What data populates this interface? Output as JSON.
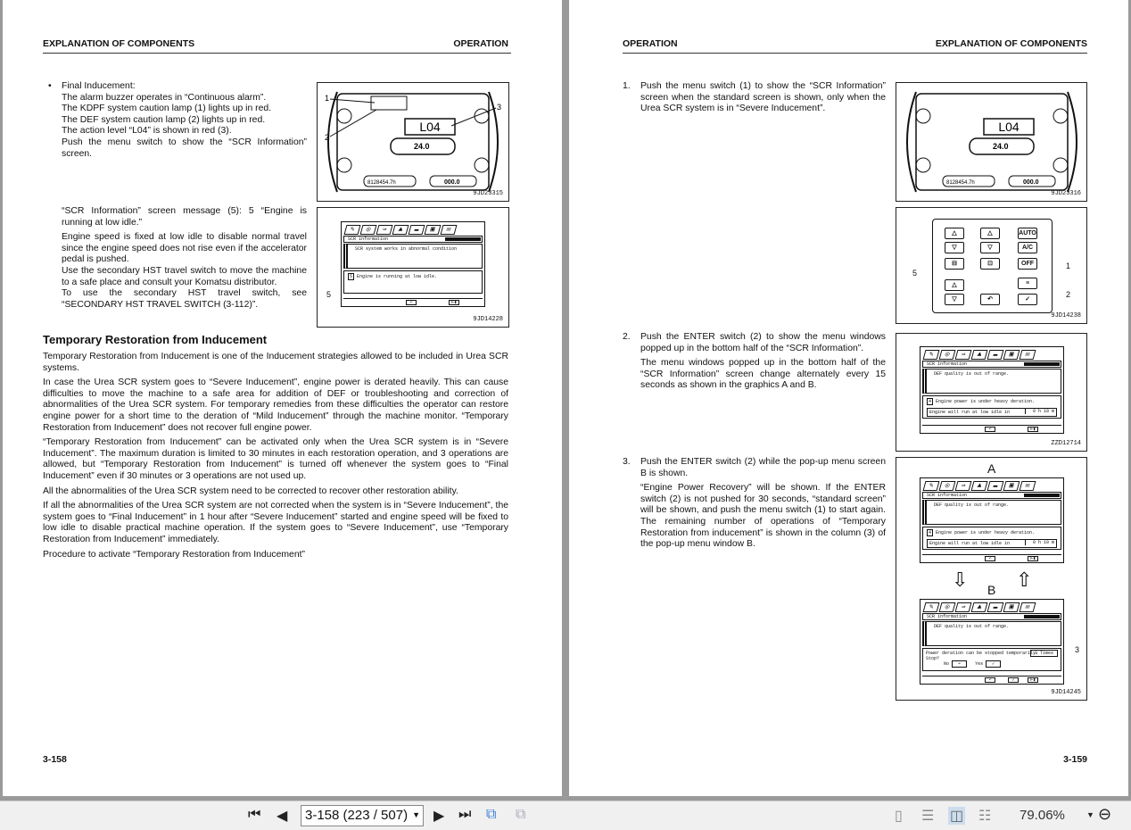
{
  "left_page": {
    "header_left": "EXPLANATION OF COMPONENTS",
    "header_right": "OPERATION",
    "page_number": "3-158",
    "bullet": "•",
    "final_inducement": [
      "Final Inducement:",
      "The alarm buzzer operates in “Continuous alarm”.",
      "The KDPF system caution lamp (1) lights up in red.",
      "The DEF system caution lamp (2) lights up in red.",
      "The action level “L04” is shown in red (3).",
      "Push the menu switch to show the “SCR Information” screen."
    ],
    "scr_message": [
      "“SCR Information” screen message (5): 5 “Engine is running at low idle.”",
      "Engine speed is fixed at low idle to disable normal travel since the engine speed does not rise even if the accelerator pedal is pushed.",
      "Use the secondary HST travel switch to move the machine to a safe place and consult your Komatsu distributor.",
      "To use the secondary HST travel switch, see “SECONDARY HST TRAVEL SWITCH (3-112)”."
    ],
    "section_title": "Temporary Restoration from Inducement",
    "paragraphs": [
      "Temporary Restoration from Inducement is one of the Inducement strategies allowed to be included in Urea SCR systems.",
      "In case the Urea SCR system goes to “Severe Inducement”, engine power is derated heavily. This can cause difficulties to move the machine to a safe area for addition of DEF or troubleshooting and correction of abnormalities of the Urea SCR system. For temporary remedies from these difficulties the operator can restore engine power for a short time to the deration of “Mild Inducement” through the machine monitor. “Temporary Restoration from Inducement” does not recover full engine power.",
      "“Temporary Restoration from Inducement” can be activated only when the Urea SCR system is in “Severe Inducement”. The maximum duration is limited to 30 minutes in each restoration operation, and 3 operations are allowed, but “Temporary Restoration from Inducement” is turned off whenever the system goes to “Final Inducement” even if 30 minutes or 3 operations are not used up.",
      "All the abnormalities of the Urea SCR system need to be corrected to recover other restoration ability.",
      "If all the abnormalities of the Urea SCR system are not corrected when the system is in “Severe Inducement”, the system goes to “Final Inducement” in 1 hour after “Severe Inducement” started and engine speed will be fixed to low idle to disable practical machine operation. If the system goes to “Severe Inducement”, use “Temporary Restoration from Inducement” immediately.",
      "Procedure to activate “Temporary Restoration from Inducement”"
    ],
    "fig1": {
      "id": "9JD23315",
      "level": "L04",
      "speed": "24.0",
      "hours": "8128454.7h",
      "odo": "000.0",
      "labels": [
        "1",
        "2",
        "3"
      ]
    },
    "fig2": {
      "id": "9JD14228",
      "title": "SCR information",
      "msg": "SCR system works in abnormal condition",
      "low_num": "5",
      "low": "Engine is running at low idle.",
      "label": "5"
    }
  },
  "right_page": {
    "header_left": "OPERATION",
    "header_right": "EXPLANATION OF COMPONENTS",
    "page_number": "3-159",
    "steps": [
      {
        "num": "1.",
        "text": [
          "Push the menu switch (1) to show the “SCR Information” screen when the standard screen is shown, only when the Urea SCR system is in “Severe Inducement”."
        ]
      },
      {
        "num": "2.",
        "text": [
          "Push the ENTER switch (2) to show the menu windows popped up in the bottom half of the “SCR Information”.",
          "The menu windows popped up in the bottom half of the “SCR Information” screen change alternately every 15 seconds as shown in the graphics A and B."
        ]
      },
      {
        "num": "3.",
        "text": [
          "Push the ENTER switch (2) while the pop-up menu screen B is shown.",
          "“Engine Power Recovery” will be shown. If the ENTER switch (2) is not pushed for 30 seconds, “standard screen” will be shown, and push the menu switch (1) to start again. The remaining number of operations of “Temporary Restoration from inducement” is shown in the column (3) of the pop-up menu window B."
        ]
      }
    ],
    "fig1": {
      "id": "9JD23316",
      "level": "L04",
      "speed": "24.0",
      "hours": "8128454.7h",
      "odo": "000.0"
    },
    "keypad": {
      "id": "9JD14238",
      "keys": [
        "AUTO",
        "A/C",
        "OFF"
      ],
      "labels": [
        "1",
        "2",
        "5"
      ]
    },
    "fig3": {
      "id": "ZZD12714",
      "title": "SCR information",
      "msg": "DEF quality is out of range.",
      "low_num": "4",
      "low": "Engine power is under heavy deration.",
      "row": "Engine will run at low idle in",
      "row_val": "0 h 10 m"
    },
    "fig4": {
      "id": "9JD14245",
      "a": "A",
      "b": "B",
      "title": "SCR information",
      "msg": "DEF quality is out of range.",
      "low_num": "4",
      "low": "Engine power is under heavy deration.",
      "row": "Engine will run at low idle in",
      "row_val": "0 h 10 m",
      "b_text": "Power deration can be stopped temporarily.",
      "b_text2": "Stop?",
      "b_val": "3 Times",
      "no": "No",
      "yes": "Yes",
      "label": "3"
    }
  },
  "toolbar": {
    "page_field": "3-158 (223 / 507)",
    "zoom": "79.06%"
  }
}
